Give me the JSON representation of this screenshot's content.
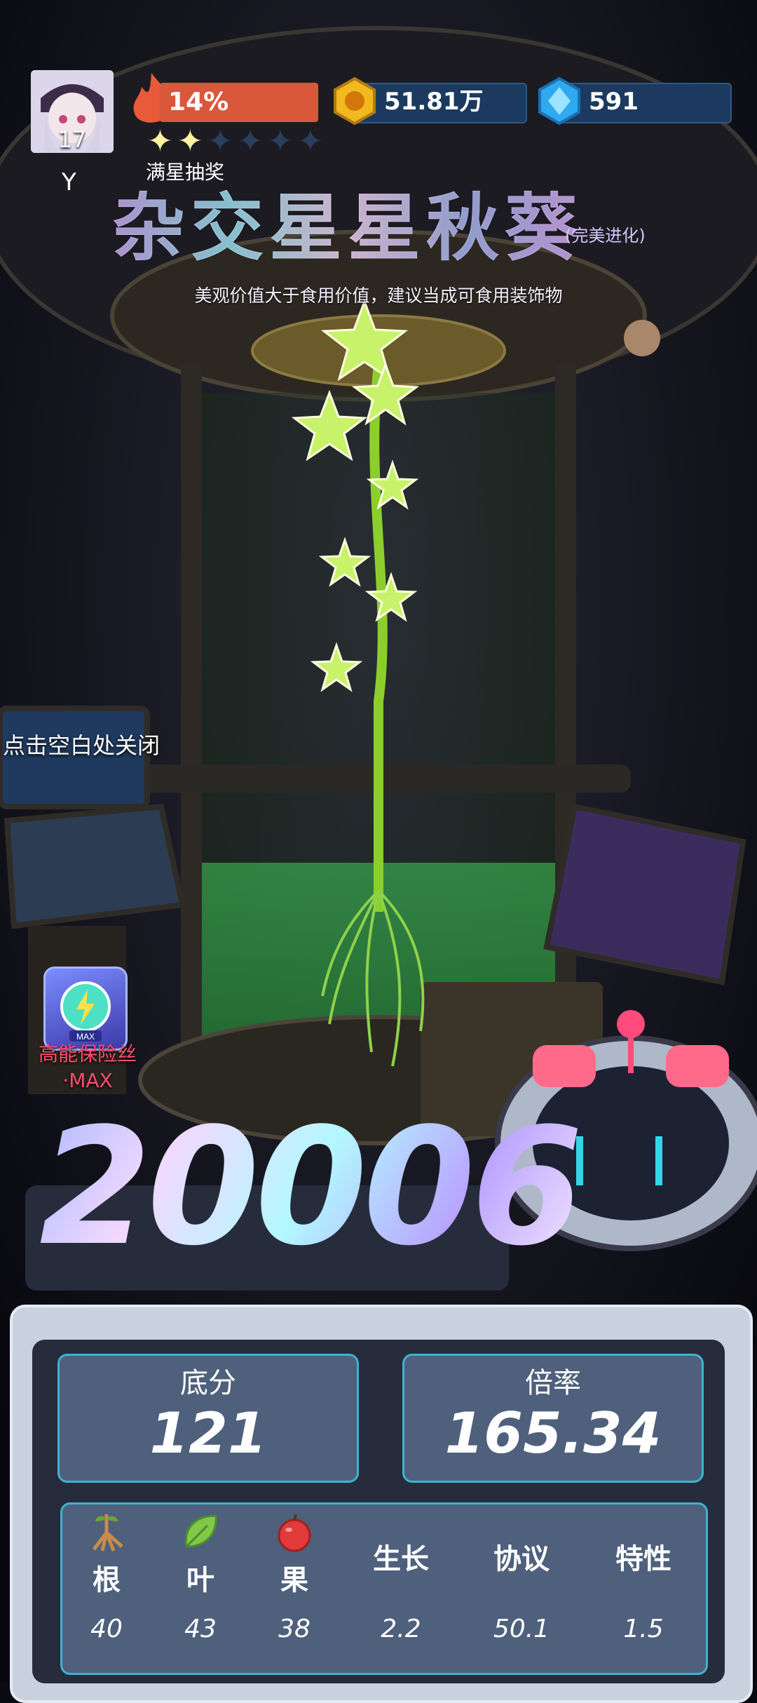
{
  "player": {
    "level": "17",
    "name": "Y"
  },
  "hud": {
    "flame_percent": "14%",
    "gold_amount": "51.81万",
    "gems_amount": "591",
    "lottery_label": "满星抽奖",
    "stars_filled": 2,
    "stars_total": 6
  },
  "plant": {
    "name": "杂交星星秋葵",
    "evolution": "(完美进化)",
    "description": "美观价值大于食用价值，建议当成可食用装饰物"
  },
  "hints": {
    "close": "点击空白处关闭"
  },
  "item": {
    "label_line1": "高能保险丝",
    "label_line2": "·MAX",
    "badge": "MAX"
  },
  "score": "20006",
  "stats": {
    "base_label": "底分",
    "base_value": "121",
    "multiplier_label": "倍率",
    "multiplier_value": "165.34"
  },
  "attributes": [
    {
      "label": "根",
      "value": "40",
      "icon": "root-icon"
    },
    {
      "label": "叶",
      "value": "43",
      "icon": "leaf-icon"
    },
    {
      "label": "果",
      "value": "38",
      "icon": "fruit-icon"
    },
    {
      "label": "生长",
      "value": "2.2"
    },
    {
      "label": "协议",
      "value": "50.1"
    },
    {
      "label": "特性",
      "value": "1.5"
    }
  ],
  "colors": {
    "flame": "#d9573b",
    "accent_cyan": "#3fb2cf",
    "fuse_red": "#ff4d6d"
  }
}
